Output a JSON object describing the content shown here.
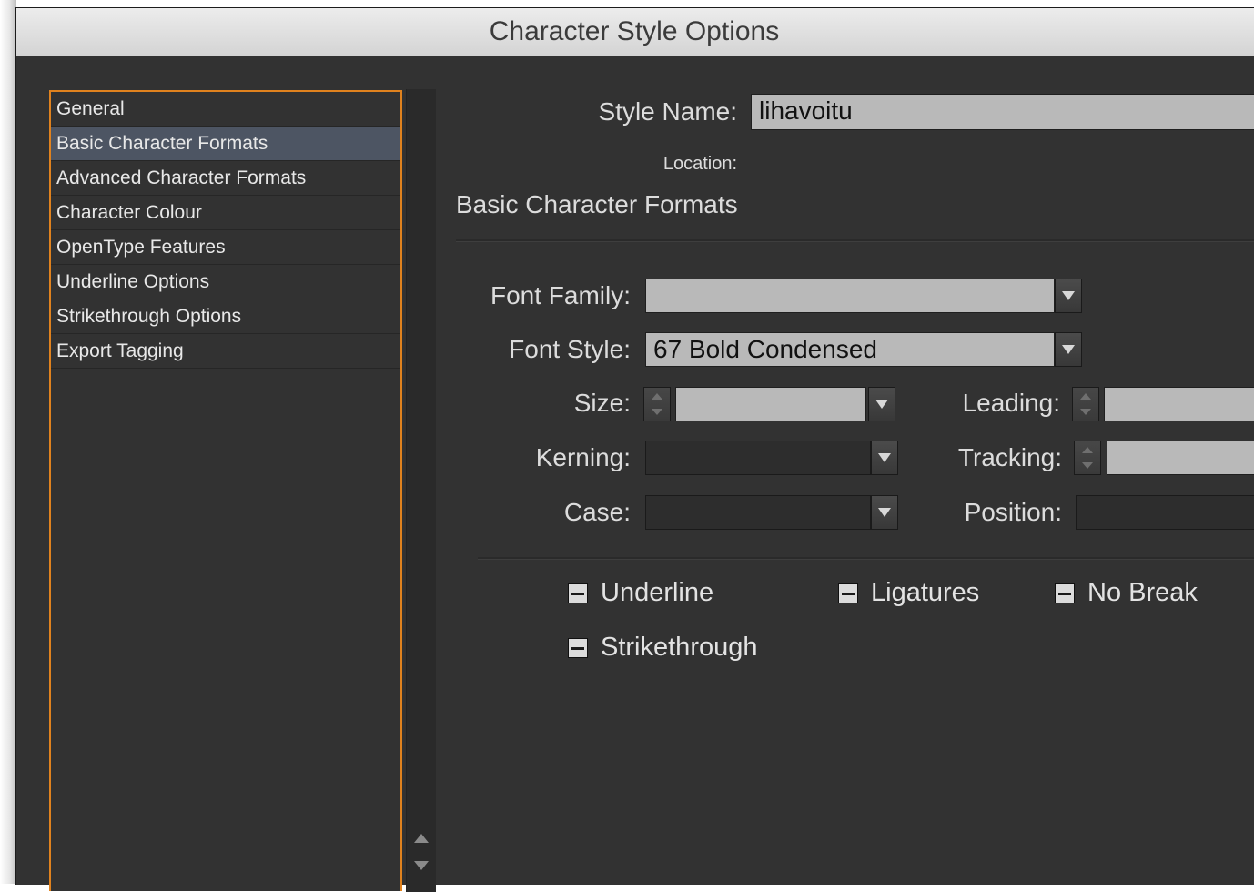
{
  "window": {
    "title": "Character Style Options"
  },
  "sidebar": {
    "items": [
      {
        "label": "General",
        "selected": false
      },
      {
        "label": "Basic Character Formats",
        "selected": true
      },
      {
        "label": "Advanced Character Formats",
        "selected": false
      },
      {
        "label": "Character Colour",
        "selected": false
      },
      {
        "label": "OpenType Features",
        "selected": false
      },
      {
        "label": "Underline Options",
        "selected": false
      },
      {
        "label": "Strikethrough Options",
        "selected": false
      },
      {
        "label": "Export Tagging",
        "selected": false
      }
    ]
  },
  "header": {
    "style_name_label": "Style Name:",
    "style_name_value": "lihavoitu",
    "location_label": "Location:"
  },
  "section": {
    "title": "Basic Character Formats"
  },
  "form": {
    "font_family": {
      "label": "Font Family:",
      "value": ""
    },
    "font_style": {
      "label": "Font Style:",
      "value": "67 Bold Condensed"
    },
    "size": {
      "label": "Size:",
      "value": ""
    },
    "leading": {
      "label": "Leading:",
      "value": ""
    },
    "kerning": {
      "label": "Kerning:",
      "value": ""
    },
    "tracking": {
      "label": "Tracking:",
      "value": ""
    },
    "case": {
      "label": "Case:",
      "value": ""
    },
    "position": {
      "label": "Position:",
      "value": ""
    }
  },
  "checkboxes": {
    "underline": {
      "label": "Underline",
      "state": "mixed"
    },
    "ligatures": {
      "label": "Ligatures",
      "state": "mixed"
    },
    "no_break": {
      "label": "No Break",
      "state": "mixed"
    },
    "strikethrough": {
      "label": "Strikethrough",
      "state": "mixed"
    }
  },
  "colors": {
    "accent_border": "#e0821e",
    "selection": "#4d5563",
    "panel": "#323232"
  }
}
